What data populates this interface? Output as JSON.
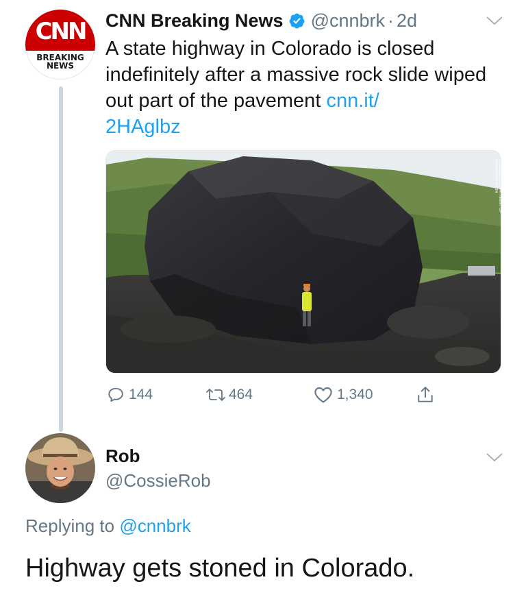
{
  "tweet": {
    "avatar_logo_text": "CNN",
    "avatar_sub_line1": "BREAKING",
    "avatar_sub_line2": "NEWS",
    "display_name": "CNN Breaking News",
    "verified": true,
    "handle": "@cnnbrk",
    "separator": "·",
    "time": "2d",
    "text": "A state highway in Colorado is closed indefinitely after a massive rock slide wiped out part of the pavement ",
    "link_part1": "cnn.it/",
    "link_part2": "2HAglbz",
    "photo_credit": "COLORADO DEPARTMENT OF TRANSPORTATION",
    "stats": {
      "replies": "144",
      "retweets": "464",
      "likes": "1,340"
    }
  },
  "reply": {
    "display_name": "Rob",
    "handle": "@CossieRob",
    "replying_prefix": "Replying to ",
    "replying_to": "@cnnbrk",
    "text": "Highway gets stoned in Colorado."
  },
  "icons": {
    "verified": "verified-badge-icon",
    "menu": "chevron-down-icon",
    "reply": "reply-icon",
    "retweet": "retweet-icon",
    "like": "heart-icon",
    "share": "share-icon"
  },
  "colors": {
    "link": "#1da1f2",
    "secondary_text": "#657786",
    "cnn_red": "#cc0000",
    "thread_line": "#ccd6dd"
  }
}
